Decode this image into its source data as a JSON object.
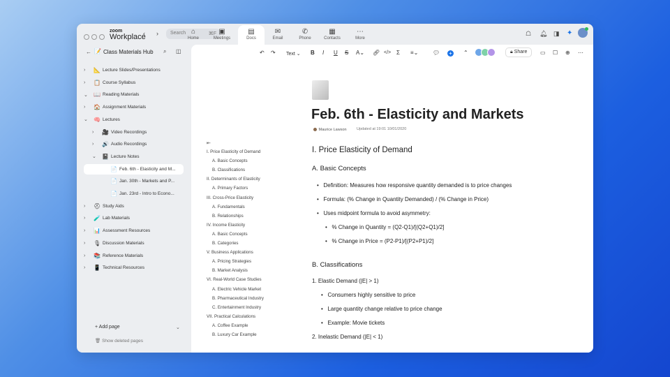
{
  "titlebar": {
    "logo_top": "zoom",
    "logo_bottom": "Workplace",
    "search_placeholder": "Search",
    "search_shortcut": "⌘F"
  },
  "tabs": [
    {
      "label": "Home",
      "icon": "home-icon"
    },
    {
      "label": "Meetings",
      "icon": "calendar-icon"
    },
    {
      "label": "Docs",
      "icon": "doc-icon",
      "active": true
    },
    {
      "label": "Email",
      "icon": "mail-icon"
    },
    {
      "label": "Phone",
      "icon": "phone-icon"
    },
    {
      "label": "Contacts",
      "icon": "contacts-icon"
    },
    {
      "label": "More",
      "icon": "more-icon"
    }
  ],
  "sidebar": {
    "title": "Class Materials Hub",
    "items": [
      {
        "label": "Lecture Slides/Presentations",
        "icon": "📐",
        "chev": "›"
      },
      {
        "label": "Course Syllabus",
        "icon": "📋",
        "chev": "›"
      },
      {
        "label": "Reading Materials",
        "icon": "📖",
        "chev": "⌄"
      },
      {
        "label": "Assignment Materials",
        "icon": "🏠",
        "chev": "›"
      },
      {
        "label": "Lectures",
        "icon": "🧠",
        "chev": "⌄"
      },
      {
        "label": "Video Recordings",
        "icon": "🎥",
        "chev": "›",
        "level": 1
      },
      {
        "label": "Audio Recordings",
        "icon": "🔊",
        "chev": "›",
        "level": 1
      },
      {
        "label": "Lecture Notes",
        "icon": "📓",
        "chev": "⌄",
        "level": 1
      },
      {
        "label": "Feb. 6th - Elasticity and M...",
        "icon": "📄",
        "level": 2,
        "selected": true
      },
      {
        "label": "Jan. 30th - Markets and P...",
        "icon": "📄",
        "level": 2
      },
      {
        "label": "Jan. 23rd - Intro to Econo...",
        "icon": "📄",
        "level": 2
      },
      {
        "label": "Study Aids",
        "icon": "⛑",
        "chev": "›"
      },
      {
        "label": "Lab Materials",
        "icon": "🧪",
        "chev": "›"
      },
      {
        "label": "Assessment Resources",
        "icon": "📊",
        "chev": "›"
      },
      {
        "label": "Discussion Materials",
        "icon": "🎙",
        "chev": "›"
      },
      {
        "label": "Reference Materials",
        "icon": "📚",
        "chev": "›"
      },
      {
        "label": "Technical Resources",
        "icon": "📱",
        "chev": "›"
      }
    ],
    "add_page": "Add page",
    "show_deleted": "Show deleted pages"
  },
  "toolbar": {
    "text_style": "Text",
    "share": "Share"
  },
  "outline": [
    "I. Price Elasticity of Demand",
    "A. Basic Concepts",
    "B. Classifications",
    "II. Determinants of Elasticity",
    "A. Primary Factors",
    "III. Cross-Price Elasticity",
    "A. Fundamentals",
    "B. Relationships",
    "IV. Income Elasticity",
    "A. Basic Concepts",
    "B. Categories",
    "V. Business Applications",
    "A. Pricing Strategies",
    "B. Market Analysis",
    "VI. Real-World Case Studies",
    "A. Electric Vehicle Market",
    "B. Pharmaceutical Industry",
    "C. Entertainment Industry",
    "VII. Practical Calculations",
    "A. Coffee Example",
    "B. Luxury Car Example"
  ],
  "doc": {
    "title": "Feb. 6th - Elasticity and Markets",
    "author": "Maurice Lawson",
    "updated": "Updated at 19:01 10/01/2020",
    "h1": "I. Price Elasticity of Demand",
    "h2a": "A. Basic Concepts",
    "bullets": [
      "Definition: Measures how responsive quantity demanded is to price changes",
      "Formula: (% Change in Quantity Demanded) / (% Change in Price)",
      "Uses midpoint formula to avoid asymmetry:"
    ],
    "sub": [
      "% Change in Quantity = (Q2-Q1)/[(Q2+Q1)/2]",
      "% Change in Price = (P2-P1)/[(P2+P1)/2]"
    ],
    "h2b": "B. Classifications",
    "n1": "1. Elastic Demand (|E| > 1)",
    "n1b": [
      "Consumers highly sensitive to price",
      "Large quantity change relative to price change",
      "Example: Movie tickets"
    ],
    "n2": "2. Inelastic Demand (|E| < 1)"
  },
  "colors": {
    "accent": "#1a73e8"
  }
}
